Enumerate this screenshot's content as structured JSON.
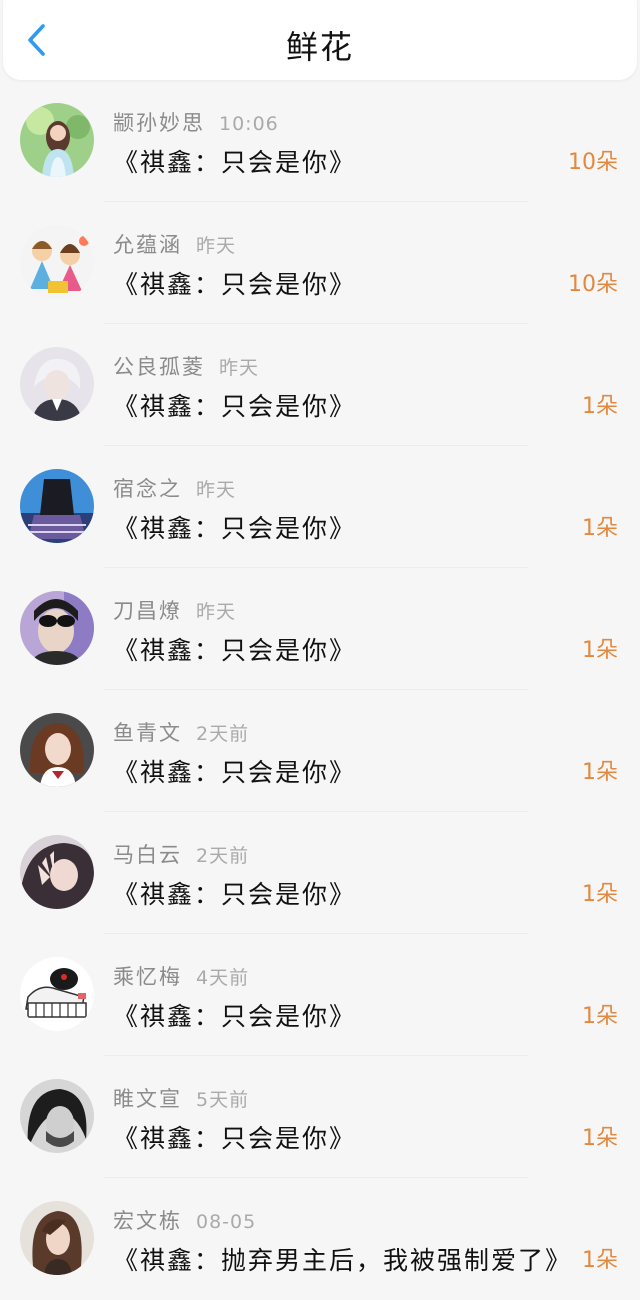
{
  "header": {
    "title": "鲜花",
    "accent_color": "#2f9bf0"
  },
  "list": [
    {
      "user": "颛孙妙思",
      "time": "10:06",
      "title": "《祺鑫：只会是你》",
      "count": "10朵"
    },
    {
      "user": "允蕴涵",
      "time": "昨天",
      "title": "《祺鑫：只会是你》",
      "count": "10朵"
    },
    {
      "user": "公良孤菱",
      "time": "昨天",
      "title": "《祺鑫：只会是你》",
      "count": "1朵"
    },
    {
      "user": "宿念之",
      "time": "昨天",
      "title": "《祺鑫：只会是你》",
      "count": "1朵"
    },
    {
      "user": "刀昌燎",
      "time": "昨天",
      "title": "《祺鑫：只会是你》",
      "count": "1朵"
    },
    {
      "user": "鱼青文",
      "time": "2天前",
      "title": "《祺鑫：只会是你》",
      "count": "1朵"
    },
    {
      "user": "马白云",
      "time": "2天前",
      "title": "《祺鑫：只会是你》",
      "count": "1朵"
    },
    {
      "user": "乘忆梅",
      "time": "4天前",
      "title": "《祺鑫：只会是你》",
      "count": "1朵"
    },
    {
      "user": "睢文宣",
      "time": "5天前",
      "title": "《祺鑫：只会是你》",
      "count": "1朵"
    },
    {
      "user": "宏文栋",
      "time": "08-05",
      "title": "《祺鑫：抛弃男主后，我被强制爱了》",
      "count": "1朵"
    }
  ],
  "colors": {
    "count": "#e3883e",
    "name": "#8b8b8b",
    "time": "#aaaaaa"
  }
}
